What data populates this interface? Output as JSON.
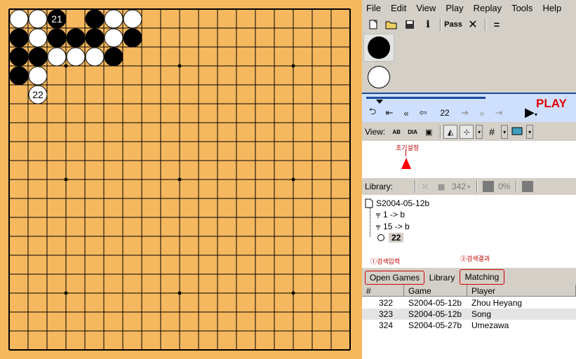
{
  "menu": [
    "File",
    "Edit",
    "View",
    "Play",
    "Replay",
    "Tools",
    "Help"
  ],
  "board": {
    "size": 19,
    "stones": [
      {
        "c": "w",
        "col": 0,
        "row": 0
      },
      {
        "c": "w",
        "col": 1,
        "row": 0
      },
      {
        "c": "b",
        "col": 2,
        "row": 0,
        "label": "21"
      },
      {
        "c": "b",
        "col": 4,
        "row": 0
      },
      {
        "c": "w",
        "col": 5,
        "row": 0
      },
      {
        "c": "w",
        "col": 6,
        "row": 0
      },
      {
        "c": "b",
        "col": 0,
        "row": 1
      },
      {
        "c": "w",
        "col": 1,
        "row": 1
      },
      {
        "c": "b",
        "col": 2,
        "row": 1
      },
      {
        "c": "b",
        "col": 3,
        "row": 1
      },
      {
        "c": "b",
        "col": 4,
        "row": 1
      },
      {
        "c": "w",
        "col": 5,
        "row": 1
      },
      {
        "c": "b",
        "col": 6,
        "row": 1
      },
      {
        "c": "b",
        "col": 0,
        "row": 2
      },
      {
        "c": "b",
        "col": 1,
        "row": 2
      },
      {
        "c": "w",
        "col": 2,
        "row": 2
      },
      {
        "c": "w",
        "col": 3,
        "row": 2
      },
      {
        "c": "w",
        "col": 4,
        "row": 2
      },
      {
        "c": "b",
        "col": 5,
        "row": 2
      },
      {
        "c": "b",
        "col": 0,
        "row": 3
      },
      {
        "c": "w",
        "col": 1,
        "row": 3
      },
      {
        "c": "w",
        "col": 1,
        "row": 4,
        "label": "22"
      }
    ],
    "hoshi": [
      [
        3,
        3
      ],
      [
        9,
        3
      ],
      [
        15,
        3
      ],
      [
        3,
        9
      ],
      [
        9,
        9
      ],
      [
        15,
        9
      ],
      [
        3,
        15
      ],
      [
        9,
        15
      ],
      [
        15,
        15
      ]
    ]
  },
  "toolbar": {
    "pass_label": "Pass",
    "eq": "="
  },
  "nav": {
    "move_number": "22",
    "play_label": "PLAY"
  },
  "view": {
    "label": "View:",
    "view_ab": "AB",
    "view_dia": "DIA"
  },
  "library": {
    "label": "Library:",
    "annot_init": "초기설정",
    "count": "342",
    "pct": "0%"
  },
  "tree": {
    "root": "S2004-05-12b",
    "branches": [
      {
        "text": "1 -> b"
      },
      {
        "text": "15 -> b"
      }
    ],
    "current": "22"
  },
  "annotations": {
    "search_input": "①검색입력",
    "search_result": "②검색결과"
  },
  "tabs": [
    "Open Games",
    "Library",
    "Matching"
  ],
  "table": {
    "headers": [
      "#",
      "Game",
      "Player"
    ],
    "rows": [
      {
        "num": "322",
        "game": "S2004-05-12b",
        "player": "Zhou Heyang"
      },
      {
        "num": "323",
        "game": "S2004-05-12b",
        "player": "Song"
      },
      {
        "num": "324",
        "game": "S2004-05-27b",
        "player": "Umezawa"
      }
    ]
  },
  "colors": {
    "board": "#f6b85e",
    "play_red": "#e00000",
    "nav_blue": "#1a4aa0",
    "annotation_red": "#c00000"
  }
}
